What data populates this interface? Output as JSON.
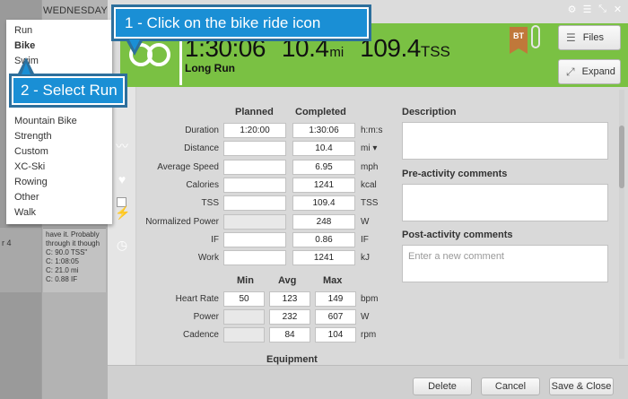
{
  "background": {
    "day_header": "WEDNESDAY",
    "week_label": "r 4",
    "note_lines": [
      "have it. Probably",
      "through it though",
      "C: 90.0 TSS\"",
      "C: 1:08:05",
      "C: 21.0 mi",
      "C: 0.88 IF"
    ]
  },
  "menu": {
    "items": [
      {
        "label": "Run"
      },
      {
        "label": "Bike"
      },
      {
        "label": "Swim"
      },
      {
        "label": "Mountain Bike"
      },
      {
        "label": "Strength"
      },
      {
        "label": "Custom"
      },
      {
        "label": "XC-Ski"
      },
      {
        "label": "Rowing"
      },
      {
        "label": "Other"
      },
      {
        "label": "Walk"
      }
    ]
  },
  "callouts": {
    "step1": "1 - Click on the bike ride icon",
    "step2": "2 - Select Run"
  },
  "header": {
    "duration": "1:30:06",
    "distance": "10.4",
    "distance_unit": "mi",
    "tss": "109.4",
    "tss_unit": "TSS",
    "workout_title": "Long Run",
    "badge": "BT",
    "files_label": "Files",
    "expand_label": "Expand"
  },
  "columns": {
    "planned": "Planned",
    "completed": "Completed",
    "min": "Min",
    "avg": "Avg",
    "max": "Max"
  },
  "metrics": [
    {
      "label": "Duration",
      "planned": "1:20:00",
      "completed": "1:30:06",
      "unit": "h:m:s"
    },
    {
      "label": "Distance",
      "planned": "",
      "completed": "10.4",
      "unit": "mi ▾"
    },
    {
      "label": "Average Speed",
      "planned": "",
      "completed": "6.95",
      "unit": "mph"
    },
    {
      "label": "Calories",
      "planned": "",
      "completed": "1241",
      "unit": "kcal"
    },
    {
      "label": "TSS",
      "planned": "",
      "completed": "109.4",
      "unit": "TSS"
    },
    {
      "label": "Normalized Power",
      "planned": "",
      "completed": "248",
      "unit": "W"
    },
    {
      "label": "IF",
      "planned": "",
      "completed": "0.86",
      "unit": "IF"
    },
    {
      "label": "Work",
      "planned": "",
      "completed": "1241",
      "unit": "kJ"
    }
  ],
  "ranges": [
    {
      "label": "Heart Rate",
      "min": "50",
      "avg": "123",
      "max": "149",
      "unit": "bpm"
    },
    {
      "label": "Power",
      "min": "",
      "avg": "232",
      "max": "607",
      "unit": "W"
    },
    {
      "label": "Cadence",
      "min": "",
      "avg": "84",
      "max": "104",
      "unit": "rpm"
    }
  ],
  "equipment_title": "Equipment",
  "description": {
    "title": "Description"
  },
  "pre_comments": {
    "title": "Pre-activity comments"
  },
  "post_comments": {
    "title": "Post-activity comments",
    "placeholder": "Enter a new comment"
  },
  "footer": {
    "delete": "Delete",
    "cancel": "Cancel",
    "save": "Save & Close"
  },
  "colors": {
    "header_green": "#7ac143",
    "callout_blue": "#1a8fd5",
    "badge": "#c0783a"
  }
}
